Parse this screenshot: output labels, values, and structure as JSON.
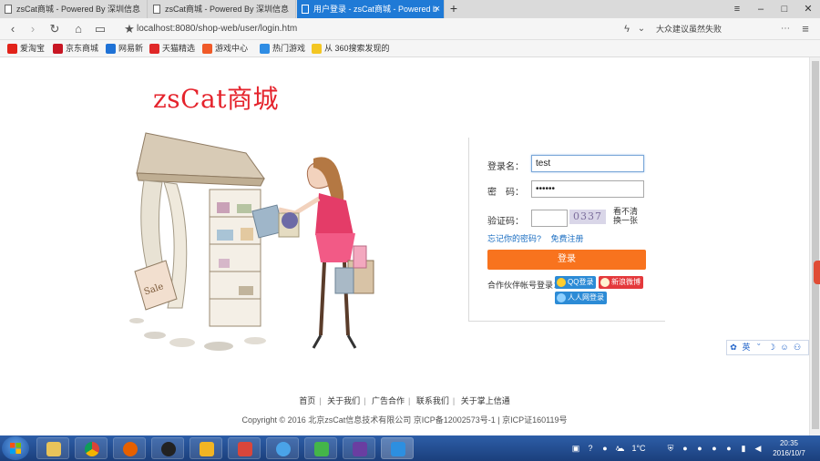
{
  "browser": {
    "tabs": [
      {
        "title": "zsCat商城 - Powered By 深圳信息",
        "active": false
      },
      {
        "title": "zsCat商城 - Powered By 深圳信息",
        "active": false
      },
      {
        "title": "用户登录 - zsCat商城 - Powered b",
        "active": true
      }
    ],
    "new_tab": "+",
    "window_controls": {
      "menu": "≡",
      "minimize": "–",
      "maximize": "□",
      "close": "✕"
    },
    "url": "localhost:8080/shop-web/user/login.htm",
    "search_hint": "大众建议虽然失败",
    "bookmarks": [
      "爱淘宝",
      "京东商城",
      "网易新",
      "天猫精选",
      "游戏中心",
      "热门游戏",
      "从 360搜索发现的"
    ]
  },
  "page": {
    "logo": "zsCat商城",
    "form": {
      "username_label": "登录名：",
      "username_value": "test",
      "password_label": "密　码：",
      "password_value": "••••••",
      "captcha_label": "验证码：",
      "captcha_value": "",
      "captcha_text": "0337",
      "captcha_refresh": "看不清换一张",
      "forgot_password": "忘记你的密码?",
      "register": "免费注册",
      "login_button": "登录",
      "partner_label": "合作伙伴帐号登录：",
      "partners": [
        "QQ登录",
        "新浪微博",
        "人人网登录"
      ]
    },
    "ime_toolbar": [
      "英",
      "˘",
      "☽",
      "☺",
      "⚇",
      "▣"
    ],
    "footer": {
      "links": [
        "首页",
        "关于我们",
        "广告合作",
        "联系我们",
        "关于掌上信通"
      ],
      "copyright": "Copyright © 2016 北京zsCat信息技术有限公司 京ICP备12002573号-1 | 京ICP证160119号"
    }
  },
  "taskbar": {
    "temperature": "1°C",
    "time": "20:35",
    "date": "2016/10/7"
  },
  "colors": {
    "accent_tab": "#1f7ad6",
    "logo": "#e5232c",
    "login_button": "#f8731e",
    "link": "#1b6ec2"
  }
}
